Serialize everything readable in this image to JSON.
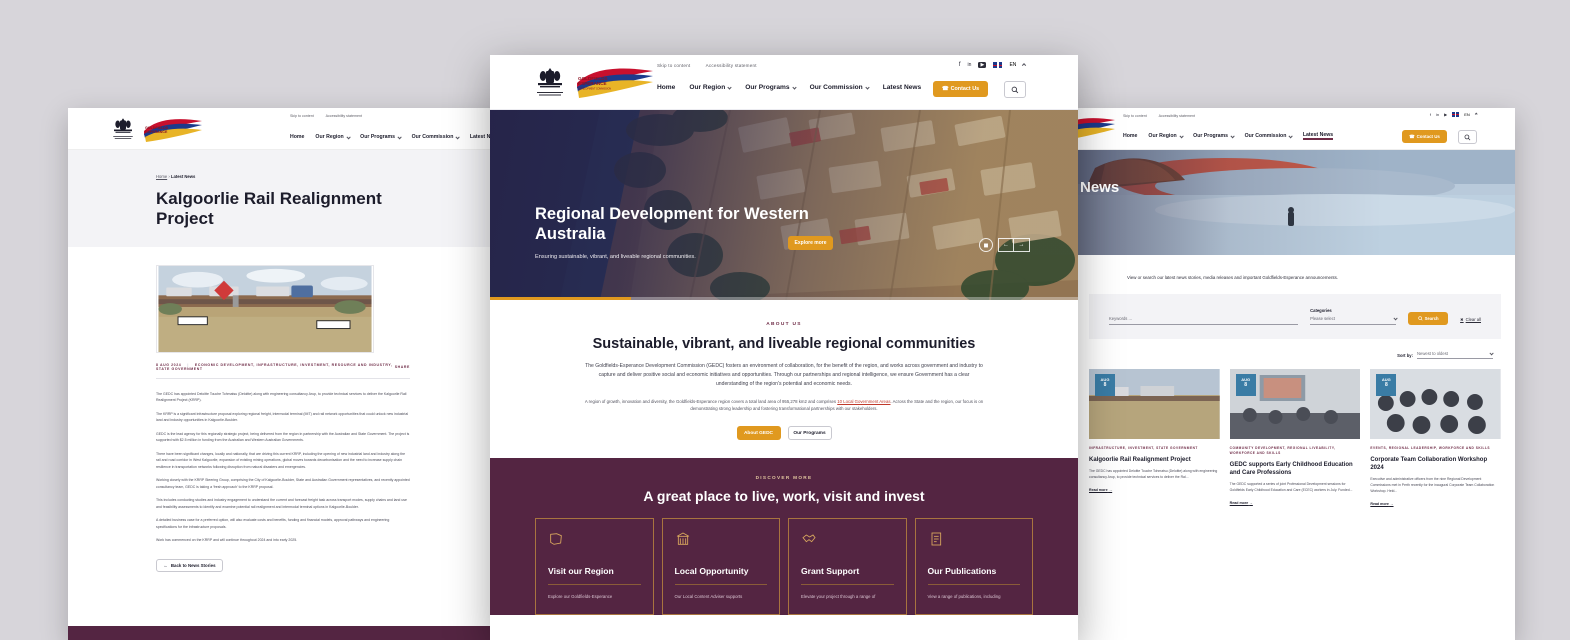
{
  "site": {
    "utility": {
      "skip": "Skip to content",
      "accessibility": "Accessibility statement"
    },
    "nav": [
      "Home",
      "Our Region",
      "Our Programs",
      "Our Commission",
      "Latest News"
    ],
    "lang": "EN",
    "contact_label": "Contact Us",
    "search_icon": "search-icon",
    "social": [
      "facebook-icon",
      "linkedin-icon",
      "youtube-icon"
    ],
    "crest_caption": "GOVERNMENT OF WESTERN AUSTRALIA",
    "logo_text": "GOLDFIELDS ESPERANCE",
    "logo_subtext": "DEVELOPMENT COMMISSION"
  },
  "center_window": {
    "hero": {
      "title": "Regional Development for Western Australia",
      "subtitle": "Ensuring sustainable, vibrant, and liveable regional communities.",
      "cta": "Explore more",
      "pause_icon": "pause-icon",
      "prev_icon": "arrow-left-icon",
      "next_icon": "arrow-right-icon"
    },
    "about": {
      "eyebrow": "ABOUT US",
      "heading": "Sustainable, vibrant, and liveable regional communities",
      "lead": "The Goldfields-Esperance Development Commission (GEDC) fosters an environment of collaboration, for the benefit of the region, and works across government and industry to capture and deliver positive social and economic initiatives and opportunities. Through our partnerships and regional intelligence, we ensure Government has a clear understanding of the region's potential and economic needs.",
      "small_prefix": "A region of growth, innovation and diversity, the Goldfields-Esperance region covers a total land area of 955,278 km2 and comprises ",
      "small_link": "10 Local Government Areas",
      "small_suffix": ". Across the State and the region, our focus is on demonstrating strong leadership and fostering transformational partnerships with our stakeholders.",
      "btn_primary": "About GEDC",
      "btn_secondary": "Our Programs"
    },
    "discover": {
      "eyebrow": "DISCOVER MORE",
      "heading": "A great place to live, work, visit and invest",
      "cards": [
        {
          "icon": "map-region-icon",
          "title": "Visit our Region",
          "desc": "Explore our Goldfields-Esperance"
        },
        {
          "icon": "shopfront-icon",
          "title": "Local Opportunity",
          "desc": "Our Local Content Adviser supports"
        },
        {
          "icon": "handshake-icon",
          "title": "Grant Support",
          "desc": "Elevate your project through a range of"
        },
        {
          "icon": "document-icon",
          "title": "Our Publications",
          "desc": "View a range of publications, including"
        }
      ]
    }
  },
  "left_window": {
    "breadcrumb_home": "Home",
    "breadcrumb_current": "Latest News",
    "title": "Kalgoorlie Rail Realignment Project",
    "image_alt": "railway-crossing-photo",
    "date": "8 AUG 2024",
    "categories": "ECONOMIC DEVELOPMENT, INFRASTRUCTURE, INVESTMENT, RESOURCE AND INDUSTRY, STATE GOVERNMENT",
    "share_label": "SHARE",
    "paragraphs": [
      "The GEDC has appointed Deloitte Touche Tohmatsu (Deloitte) along with engineering consultancy Arup, to provide technical services to deliver the Kalgoorlie Rail Realignment Project (KRRP).",
      "The KRRP is a significant infrastructure proposal exploring regional freight, intermodal terminal (IMT) and rail network opportunities that could unlock new industrial land and industry opportunities in Kalgoorlie-Boulder.",
      "GEDC is the lead agency for this regionally strategic project, being delivered from the region in partnership with the Australian and State Government. The project is supported with $2.5 million in funding from the Australian and Western Australian Governments.",
      "There have been significant changes, locally and nationally, that are driving this current KRRP, including the opening of new industrial land and industry along the rail and road corridor in West Kalgoorlie, expansion of existing mining operations, global moves towards decarbonisation and the need to increase supply chain resilience in transportation networks following disruption from natural disasters and emergencies.",
      "Working closely with the KRRP Steering Group, comprising the City of Kalgoorlie-Boulder, State and Australian Government representatives, and recently appointed consultancy team, GEDC is taking a 'fresh approach' to the KRRP proposal.",
      "This includes conducting studies and industry engagement to understand the current and forecast freight task across transport modes, supply chains and land use and feasibility assessments to identify and examine potential rail realignment and intermodal terminal options in Kalgoorlie-Boulder.",
      "A detailed business case for a preferred option, will also evaluate costs and benefits, funding and financial models, approval pathways and engineering specifications for the infrastructure proposals.",
      "Work has commenced on the KRRP and will continue throughout 2024 and into early 2025."
    ],
    "back_label": "Back to News Stories"
  },
  "right_window": {
    "hero_title": "News",
    "intro": "View or search our latest news stories, media releases and important Goldfields-Esperance announcements.",
    "filters": {
      "keyword_placeholder": "Keywords ...",
      "categories_label": "Categories",
      "categories_value": "Please select",
      "search_label": "Search",
      "clear_label": "Clear all"
    },
    "sort": {
      "label": "Sort by:",
      "value": "Newest to oldest"
    },
    "news": [
      {
        "month": "AUG",
        "day": "8",
        "category": "INFRASTRUCTURE, INVESTMENT, STATE GOVERNMENT",
        "title": "Kalgoorlie Rail Realignment Project",
        "desc": "The GEDC has appointed Deloitte Touche Tohmatsu (Deloitte) along with engineering consultancy Arup, to provide technical services to deliver the Ral...",
        "read_more": "Read more"
      },
      {
        "month": "AUG",
        "day": "8",
        "category": "COMMUNITY DEVELOPMENT, REGIONAL LIVEABILITY, WORKFORCE AND SKILLS",
        "title": "GEDC supports Early Childhood Education and Care Professions",
        "desc": "The GEDC supported a series of joint Professional Development sessions for Goldfields Early Childhood Education and Care (ECEC) workers in July. Funded...",
        "read_more": "Read more"
      },
      {
        "month": "AUG",
        "day": "8",
        "category": "EVENTS, REGIONAL LEADERSHIP, WORKFORCE AND SKILLS",
        "title": "Corporate Team Collaboration Workshop 2024",
        "desc": "Executive and administrative officers from the nine Regional Development Commissions met in Perth recently for the inaugural Corporate Team Collaboration Workshop.  Held...",
        "read_more": "Read more"
      }
    ]
  },
  "colors": {
    "accent_orange": "#e0991f",
    "brand_maroon": "#6f2c47",
    "discover_bg": "#542542",
    "badge_blue": "#3a7ca5"
  }
}
